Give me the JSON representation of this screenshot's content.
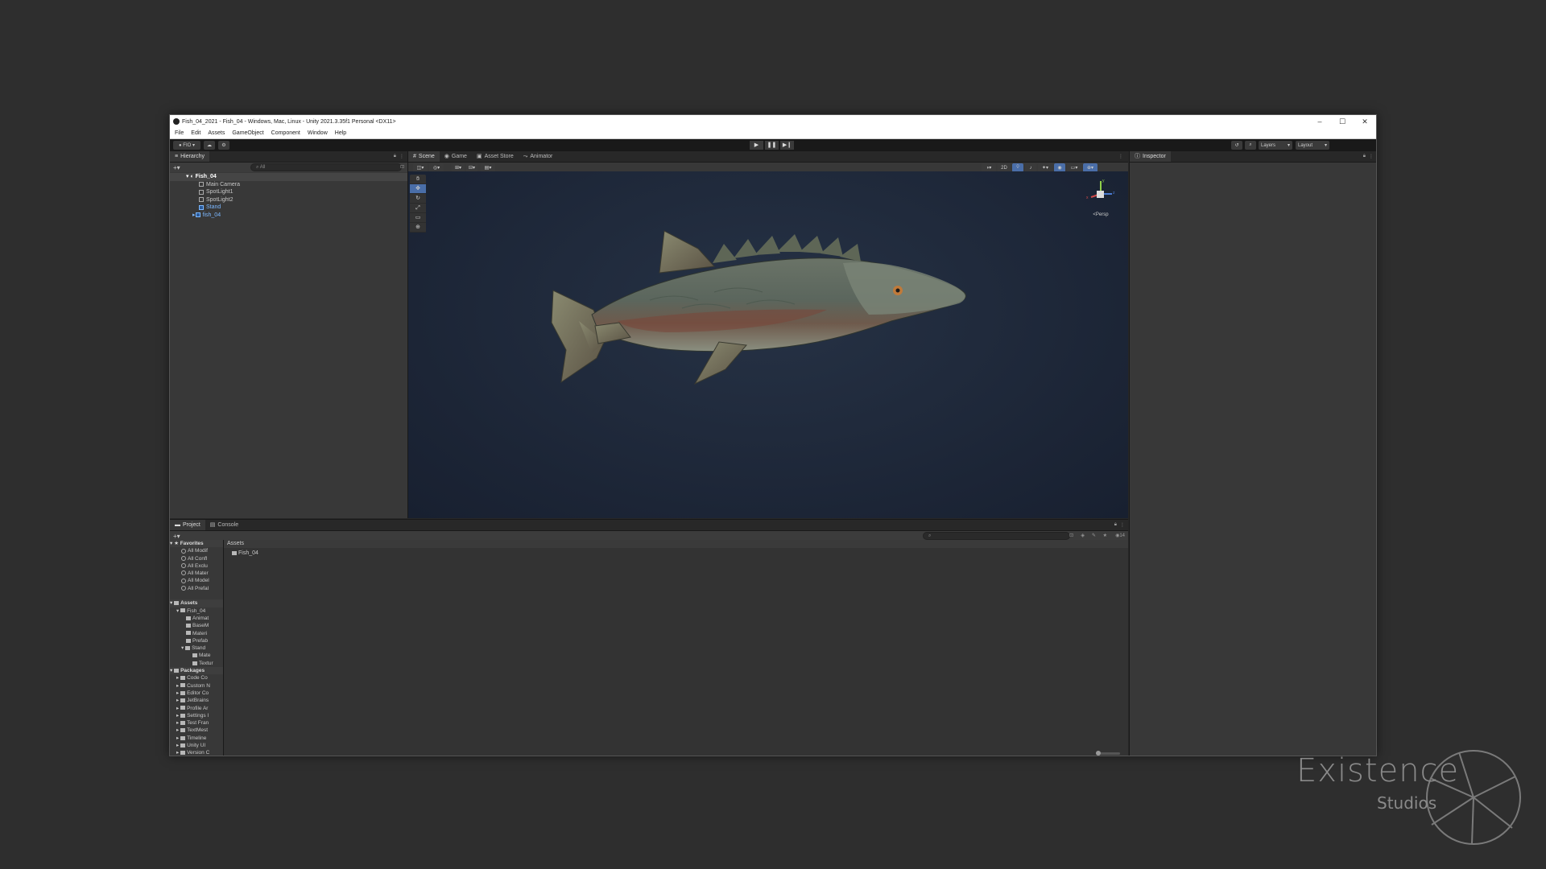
{
  "window": {
    "title": "Fish_04_2021 - Fish_04 - Windows, Mac, Linux - Unity 2021.3.35f1 Personal <DX11>",
    "controls": [
      "–",
      "☐",
      "✕"
    ]
  },
  "menu": [
    "File",
    "Edit",
    "Assets",
    "GameObject",
    "Component",
    "Window",
    "Help"
  ],
  "toolbar": {
    "account_label": "FIO",
    "layers_label": "Layers",
    "layout_label": "Layout",
    "play_icons": [
      "▶",
      "❚❚",
      "▶❙"
    ]
  },
  "hierarchy": {
    "tab_label": "Hierarchy",
    "search_placeholder": "All",
    "items": [
      {
        "label": "Fish_04",
        "depth": 0,
        "selected": true
      },
      {
        "label": "Main Camera",
        "depth": 1
      },
      {
        "label": "SpotLight1",
        "depth": 1
      },
      {
        "label": "SpotLight2",
        "depth": 1
      },
      {
        "label": "Stand",
        "depth": 1,
        "prefab": true
      },
      {
        "label": "fish_04",
        "depth": 1,
        "prefab": true
      }
    ]
  },
  "scene": {
    "tabs": [
      "Scene",
      "Game",
      "Asset Store",
      "Animator"
    ],
    "mode_2d": "2D",
    "gizmo_label": "<Persp",
    "gizmo_axes": [
      "y",
      "x",
      "z"
    ]
  },
  "inspector": {
    "tab_label": "Inspector"
  },
  "project": {
    "tabs": [
      "Project",
      "Console"
    ],
    "favorites_label": "Favorites",
    "favorites": [
      "All Modif",
      "All Confl",
      "All Exclu",
      "All Mater",
      "All Model",
      "All Prefal"
    ],
    "assets_label": "Assets",
    "asset_tree": [
      {
        "label": "Fish_04",
        "depth": 1
      },
      {
        "label": "Animat",
        "depth": 2
      },
      {
        "label": "BaseM",
        "depth": 2
      },
      {
        "label": "Materi",
        "depth": 2
      },
      {
        "label": "Prefab",
        "depth": 2
      },
      {
        "label": "Stand",
        "depth": 2
      },
      {
        "label": "Mate",
        "depth": 3
      },
      {
        "label": "Textur",
        "depth": 3
      }
    ],
    "packages_label": "Packages",
    "packages": [
      "Code Co",
      "Custom N",
      "Editor Co",
      "JetBrains",
      "Profile Ar",
      "Settings I",
      "Test Fran",
      "TextMest",
      "Timeline",
      "Unity UI",
      "Version C"
    ],
    "breadcrumb": "Assets",
    "content_items": [
      "Fish_04"
    ],
    "count_label": "14"
  },
  "watermark": {
    "line1": "Existence",
    "line2": "Studios"
  },
  "colors": {
    "selection": "#4a6ea8",
    "prefab_blue": "#7cb8ff"
  }
}
